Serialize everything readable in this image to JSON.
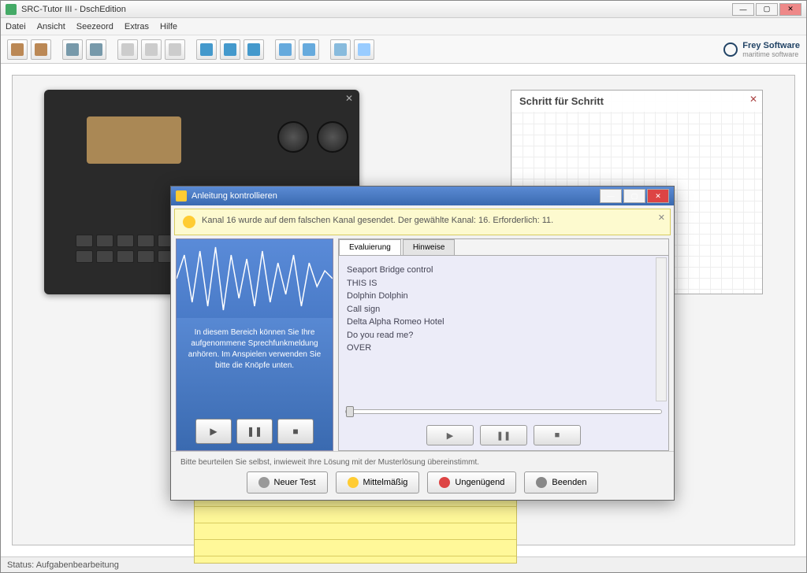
{
  "window": {
    "title": "SRC-Tutor III - DschEdition",
    "min": "—",
    "max": "▢",
    "close": "✕"
  },
  "menu": [
    "Datei",
    "Ansicht",
    "Seezeord",
    "Extras",
    "Hilfe"
  ],
  "toolbar_icons": [
    "#b85",
    "#b85",
    "#79a",
    "#79a",
    "#ccc",
    "#ccc",
    "#ccc",
    "#49c",
    "#49c",
    "#49c",
    "#6ad",
    "#6ad",
    "#8bd",
    "#ccc",
    "#9cf"
  ],
  "brand": {
    "name": "Frey Software",
    "sub": "maritime software"
  },
  "steps": {
    "title": "Schritt für Schritt"
  },
  "dialog": {
    "title": "Anleitung kontrollieren",
    "hint": "Kanal 16 wurde auf dem falschen Kanal gesendet. Der gewählte Kanal: 16. Erforderlich: 11.",
    "audio_text": "In diesem Bereich können Sie Ihre aufgenommene Sprechfunkmeldung anhören. Im Anspielen verwenden Sie bitte die Knöpfe unten.",
    "tabs": [
      "Evaluierung",
      "Hinweise"
    ],
    "eval_lines": [
      "Seaport Bridge control",
      "THIS IS",
      "Dolphin Dolphin",
      "Call sign",
      "Delta Alpha Romeo Hotel",
      "Do you read me?",
      "OVER"
    ],
    "play": "▶",
    "pause": "❚❚",
    "stop": "■",
    "footer_hint": "Bitte beurteilen Sie selbst, inwieweit Ihre Lösung mit der Musterlösung übereinstimmt.",
    "btn_repeat": "Neuer Test",
    "btn_ok": "Mittelmäßig",
    "btn_bad": "Ungenügend",
    "btn_close": "Beenden"
  },
  "status": "Status: Aufgabenbearbeitung",
  "colors": {
    "ok": "#fc3",
    "bad": "#d44",
    "neutral": "#999",
    "close": "#888"
  }
}
